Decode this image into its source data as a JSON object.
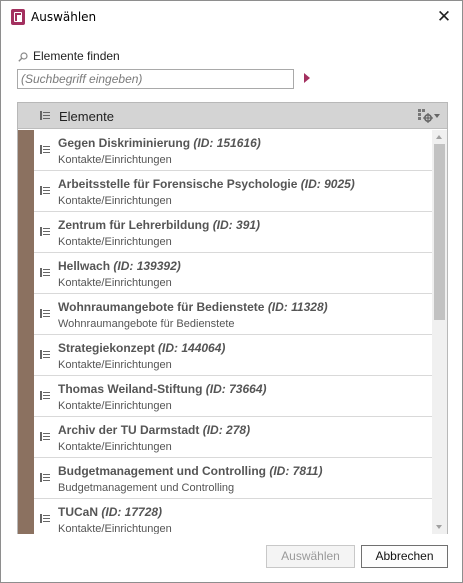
{
  "window": {
    "title": "Auswählen",
    "close_glyph": "✕",
    "accent_color": "#a3305f"
  },
  "search": {
    "label": "Elemente finden",
    "placeholder": "(Suchbegriff eingeben)",
    "value": ""
  },
  "list": {
    "header_label": "Elemente",
    "marker_color": "#8b7160",
    "items": [
      {
        "title": "Gegen Diskriminierung",
        "id": "(ID: 151616)",
        "subtitle": "Kontakte/Einrichtungen"
      },
      {
        "title": "Arbeitsstelle für Forensische Psychologie",
        "id": "(ID: 9025)",
        "subtitle": "Kontakte/Einrichtungen"
      },
      {
        "title": "Zentrum für Lehrerbildung",
        "id": "(ID: 391)",
        "subtitle": "Kontakte/Einrichtungen"
      },
      {
        "title": "Hellwach",
        "id": "(ID: 139392)",
        "subtitle": "Kontakte/Einrichtungen"
      },
      {
        "title": "Wohnraumangebote für Bedienstete",
        "id": "(ID: 11328)",
        "subtitle": "Wohnraumangebote für Bedienstete"
      },
      {
        "title": "Strategiekonzept",
        "id": "(ID: 144064)",
        "subtitle": "Kontakte/Einrichtungen"
      },
      {
        "title": "Thomas Weiland-Stiftung",
        "id": "(ID: 73664)",
        "subtitle": "Kontakte/Einrichtungen"
      },
      {
        "title": "Archiv der TU Darmstadt",
        "id": "(ID: 278)",
        "subtitle": "Kontakte/Einrichtungen"
      },
      {
        "title": "Budgetmanagement und Controlling",
        "id": "(ID: 7811)",
        "subtitle": "Budgetmanagement und Controlling"
      },
      {
        "title": "TUCaN",
        "id": "(ID: 17728)",
        "subtitle": "Kontakte/Einrichtungen"
      }
    ]
  },
  "buttons": {
    "select_label": "Auswählen",
    "cancel_label": "Abbrechen"
  }
}
